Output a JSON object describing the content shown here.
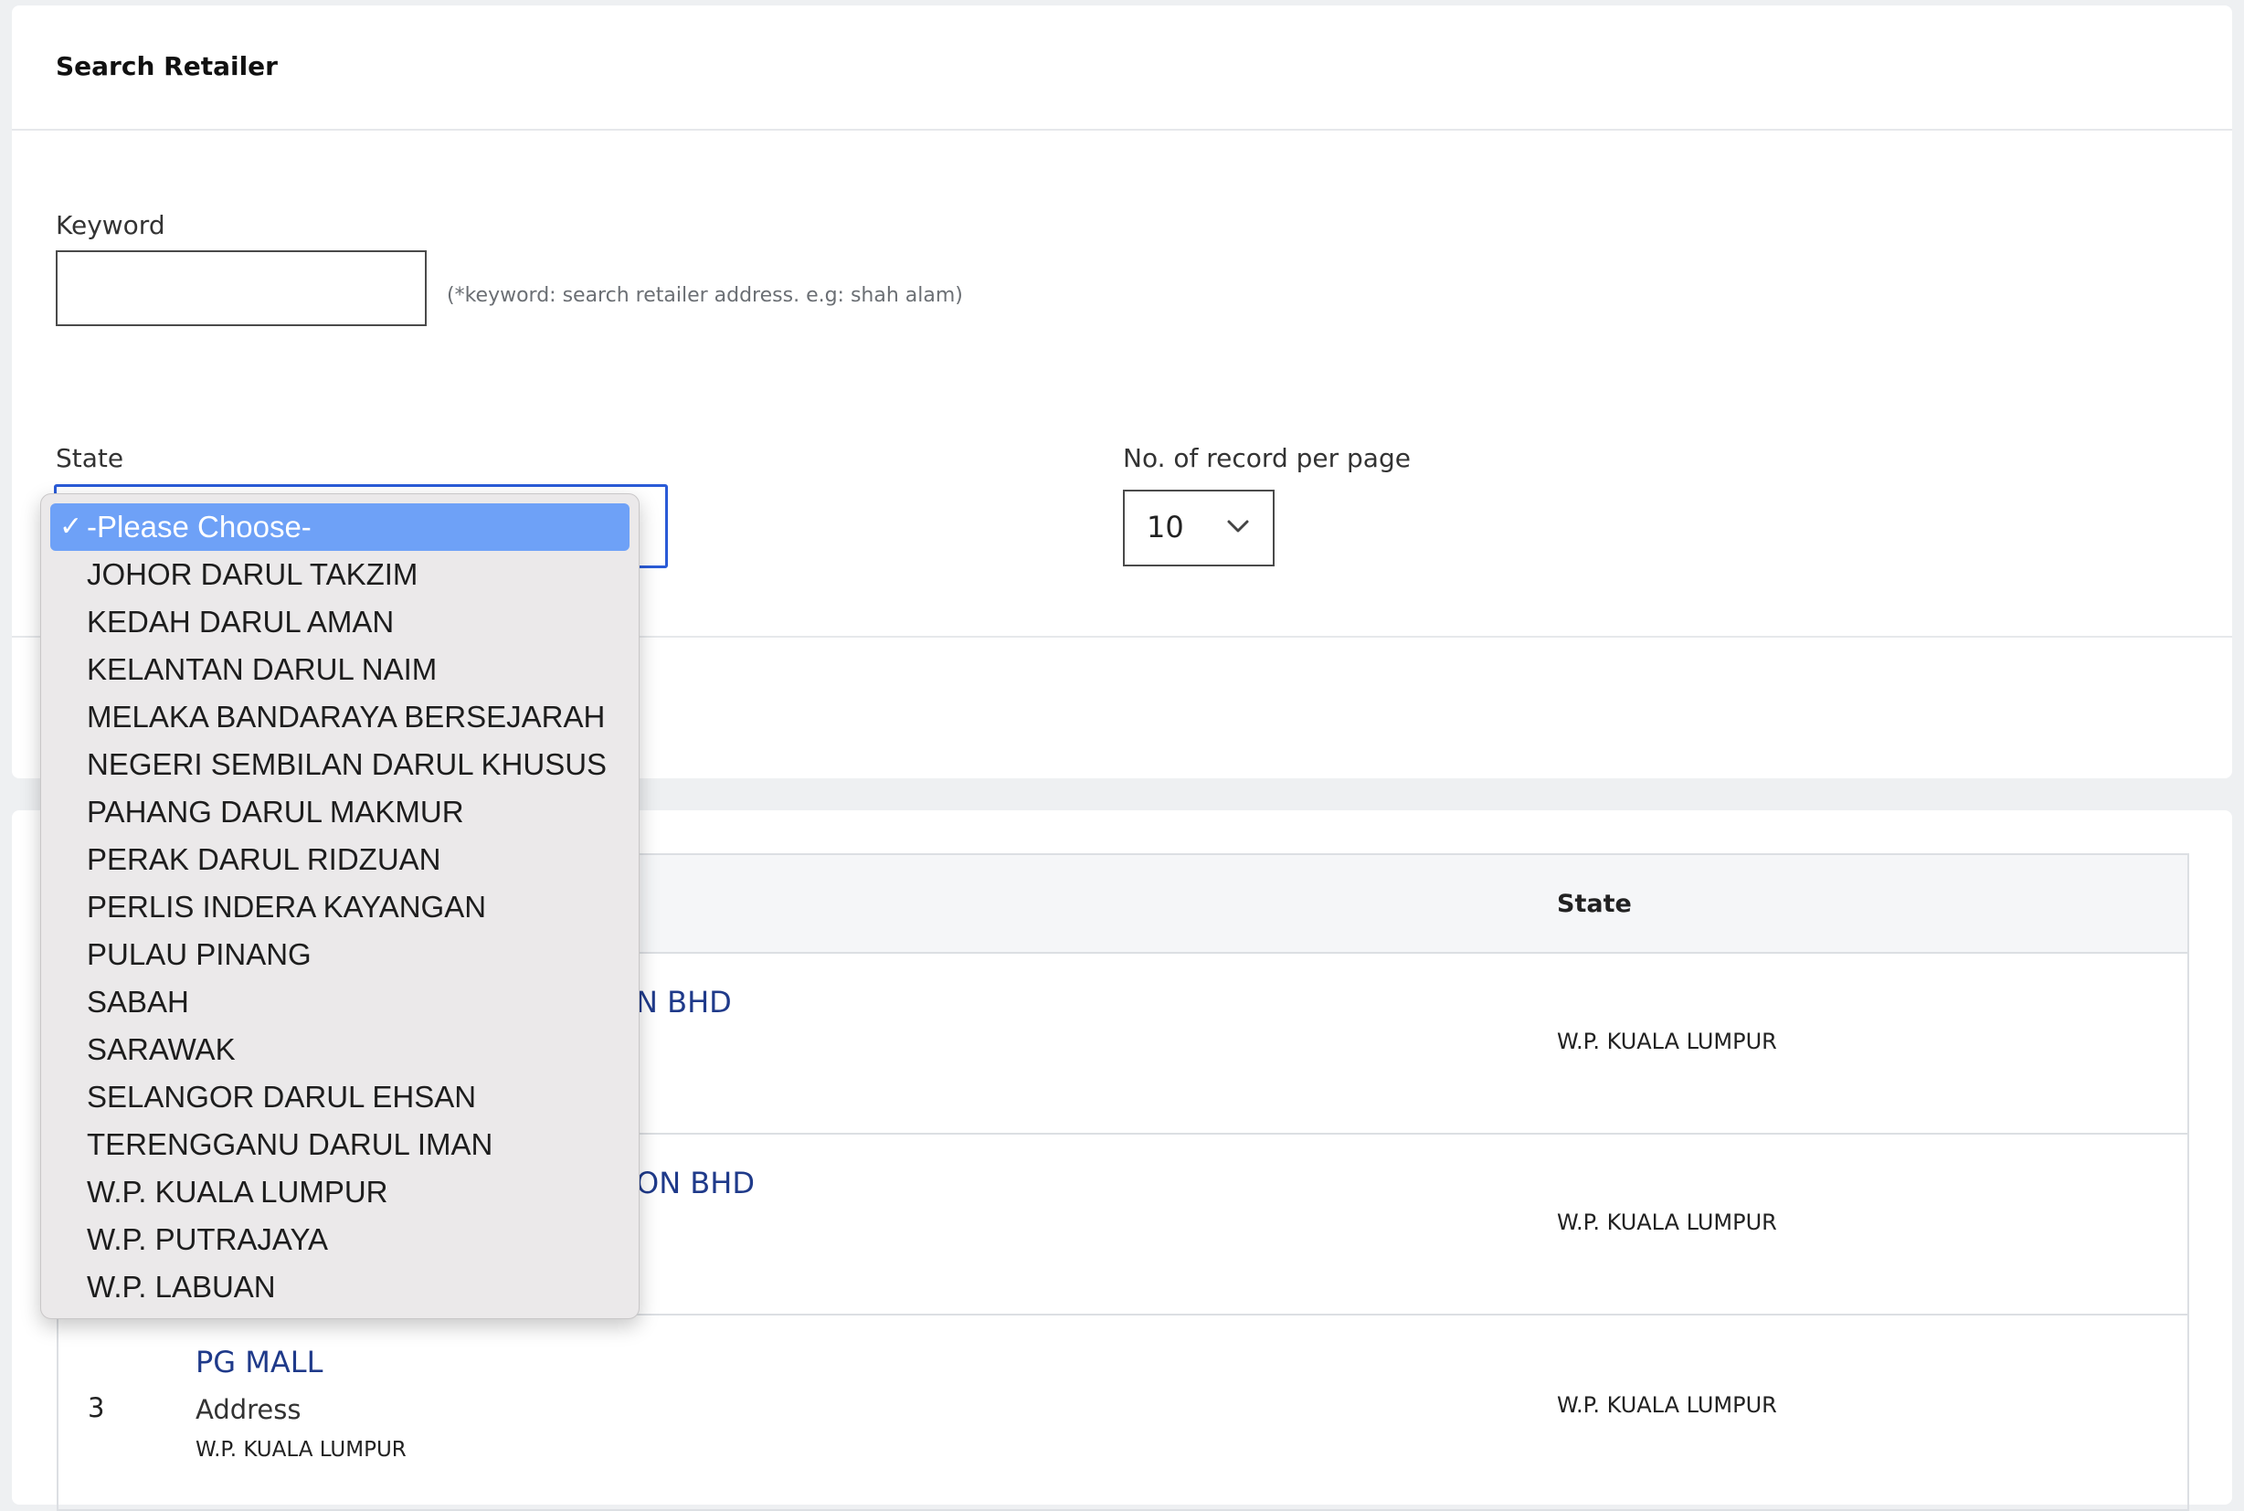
{
  "search_card": {
    "title": "Search Retailer",
    "keyword_label": "Keyword",
    "keyword_value": "",
    "keyword_hint": "(*keyword: search retailer address. e.g: shah alam)",
    "state_label": "State",
    "records_label": "No. of record per page",
    "records_value": "10"
  },
  "state_dropdown": {
    "selected": "-Please Choose-",
    "options": [
      "-Please Choose-",
      "JOHOR DARUL TAKZIM",
      "KEDAH DARUL AMAN",
      "KELANTAN DARUL NAIM",
      "MELAKA BANDARAYA BERSEJARAH",
      "NEGERI SEMBILAN DARUL KHUSUS",
      "PAHANG DARUL MAKMUR",
      "PERAK DARUL RIDZUAN",
      "PERLIS INDERA KAYANGAN",
      "PULAU PINANG",
      "SABAH",
      "SARAWAK",
      "SELANGOR DARUL EHSAN",
      "TERENGGANU DARUL IMAN",
      "W.P. KUALA LUMPUR",
      "W.P. PUTRAJAYA",
      "W.P. LABUAN"
    ],
    "check_glyph": "✓"
  },
  "results_table": {
    "state_header": "State",
    "rows": [
      {
        "no": "",
        "name_visible": "N BHD",
        "address_label": "",
        "address": "",
        "state": "W.P. KUALA LUMPUR"
      },
      {
        "no": "",
        "name_visible": "ON BHD",
        "address_label": "",
        "address": "",
        "state": "W.P. KUALA LUMPUR"
      },
      {
        "no": "3",
        "name_visible": "PG MALL",
        "address_label": "Address",
        "address": "W.P. KUALA LUMPUR",
        "state": "W.P. KUALA LUMPUR"
      }
    ]
  },
  "colors": {
    "accent_blue": "#2a5bd7",
    "selected_option": "#6ea1f7",
    "link_navy": "#1f3a8a"
  },
  "icons": {
    "records_select_icon": "chevron-down-icon"
  }
}
